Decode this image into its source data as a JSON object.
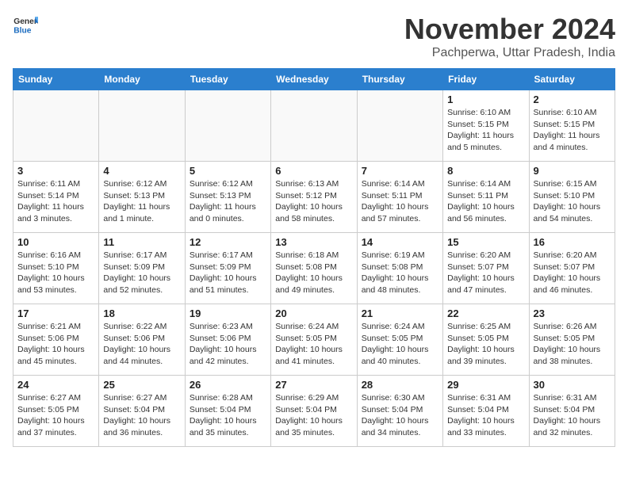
{
  "header": {
    "logo_general": "General",
    "logo_blue": "Blue",
    "month": "November 2024",
    "location": "Pachperwa, Uttar Pradesh, India"
  },
  "weekdays": [
    "Sunday",
    "Monday",
    "Tuesday",
    "Wednesday",
    "Thursday",
    "Friday",
    "Saturday"
  ],
  "weeks": [
    [
      {
        "day": "",
        "info": ""
      },
      {
        "day": "",
        "info": ""
      },
      {
        "day": "",
        "info": ""
      },
      {
        "day": "",
        "info": ""
      },
      {
        "day": "",
        "info": ""
      },
      {
        "day": "1",
        "info": "Sunrise: 6:10 AM\nSunset: 5:15 PM\nDaylight: 11 hours\nand 5 minutes."
      },
      {
        "day": "2",
        "info": "Sunrise: 6:10 AM\nSunset: 5:15 PM\nDaylight: 11 hours\nand 4 minutes."
      }
    ],
    [
      {
        "day": "3",
        "info": "Sunrise: 6:11 AM\nSunset: 5:14 PM\nDaylight: 11 hours\nand 3 minutes."
      },
      {
        "day": "4",
        "info": "Sunrise: 6:12 AM\nSunset: 5:13 PM\nDaylight: 11 hours\nand 1 minute."
      },
      {
        "day": "5",
        "info": "Sunrise: 6:12 AM\nSunset: 5:13 PM\nDaylight: 11 hours\nand 0 minutes."
      },
      {
        "day": "6",
        "info": "Sunrise: 6:13 AM\nSunset: 5:12 PM\nDaylight: 10 hours\nand 58 minutes."
      },
      {
        "day": "7",
        "info": "Sunrise: 6:14 AM\nSunset: 5:11 PM\nDaylight: 10 hours\nand 57 minutes."
      },
      {
        "day": "8",
        "info": "Sunrise: 6:14 AM\nSunset: 5:11 PM\nDaylight: 10 hours\nand 56 minutes."
      },
      {
        "day": "9",
        "info": "Sunrise: 6:15 AM\nSunset: 5:10 PM\nDaylight: 10 hours\nand 54 minutes."
      }
    ],
    [
      {
        "day": "10",
        "info": "Sunrise: 6:16 AM\nSunset: 5:10 PM\nDaylight: 10 hours\nand 53 minutes."
      },
      {
        "day": "11",
        "info": "Sunrise: 6:17 AM\nSunset: 5:09 PM\nDaylight: 10 hours\nand 52 minutes."
      },
      {
        "day": "12",
        "info": "Sunrise: 6:17 AM\nSunset: 5:09 PM\nDaylight: 10 hours\nand 51 minutes."
      },
      {
        "day": "13",
        "info": "Sunrise: 6:18 AM\nSunset: 5:08 PM\nDaylight: 10 hours\nand 49 minutes."
      },
      {
        "day": "14",
        "info": "Sunrise: 6:19 AM\nSunset: 5:08 PM\nDaylight: 10 hours\nand 48 minutes."
      },
      {
        "day": "15",
        "info": "Sunrise: 6:20 AM\nSunset: 5:07 PM\nDaylight: 10 hours\nand 47 minutes."
      },
      {
        "day": "16",
        "info": "Sunrise: 6:20 AM\nSunset: 5:07 PM\nDaylight: 10 hours\nand 46 minutes."
      }
    ],
    [
      {
        "day": "17",
        "info": "Sunrise: 6:21 AM\nSunset: 5:06 PM\nDaylight: 10 hours\nand 45 minutes."
      },
      {
        "day": "18",
        "info": "Sunrise: 6:22 AM\nSunset: 5:06 PM\nDaylight: 10 hours\nand 44 minutes."
      },
      {
        "day": "19",
        "info": "Sunrise: 6:23 AM\nSunset: 5:06 PM\nDaylight: 10 hours\nand 42 minutes."
      },
      {
        "day": "20",
        "info": "Sunrise: 6:24 AM\nSunset: 5:05 PM\nDaylight: 10 hours\nand 41 minutes."
      },
      {
        "day": "21",
        "info": "Sunrise: 6:24 AM\nSunset: 5:05 PM\nDaylight: 10 hours\nand 40 minutes."
      },
      {
        "day": "22",
        "info": "Sunrise: 6:25 AM\nSunset: 5:05 PM\nDaylight: 10 hours\nand 39 minutes."
      },
      {
        "day": "23",
        "info": "Sunrise: 6:26 AM\nSunset: 5:05 PM\nDaylight: 10 hours\nand 38 minutes."
      }
    ],
    [
      {
        "day": "24",
        "info": "Sunrise: 6:27 AM\nSunset: 5:05 PM\nDaylight: 10 hours\nand 37 minutes."
      },
      {
        "day": "25",
        "info": "Sunrise: 6:27 AM\nSunset: 5:04 PM\nDaylight: 10 hours\nand 36 minutes."
      },
      {
        "day": "26",
        "info": "Sunrise: 6:28 AM\nSunset: 5:04 PM\nDaylight: 10 hours\nand 35 minutes."
      },
      {
        "day": "27",
        "info": "Sunrise: 6:29 AM\nSunset: 5:04 PM\nDaylight: 10 hours\nand 35 minutes."
      },
      {
        "day": "28",
        "info": "Sunrise: 6:30 AM\nSunset: 5:04 PM\nDaylight: 10 hours\nand 34 minutes."
      },
      {
        "day": "29",
        "info": "Sunrise: 6:31 AM\nSunset: 5:04 PM\nDaylight: 10 hours\nand 33 minutes."
      },
      {
        "day": "30",
        "info": "Sunrise: 6:31 AM\nSunset: 5:04 PM\nDaylight: 10 hours\nand 32 minutes."
      }
    ]
  ]
}
